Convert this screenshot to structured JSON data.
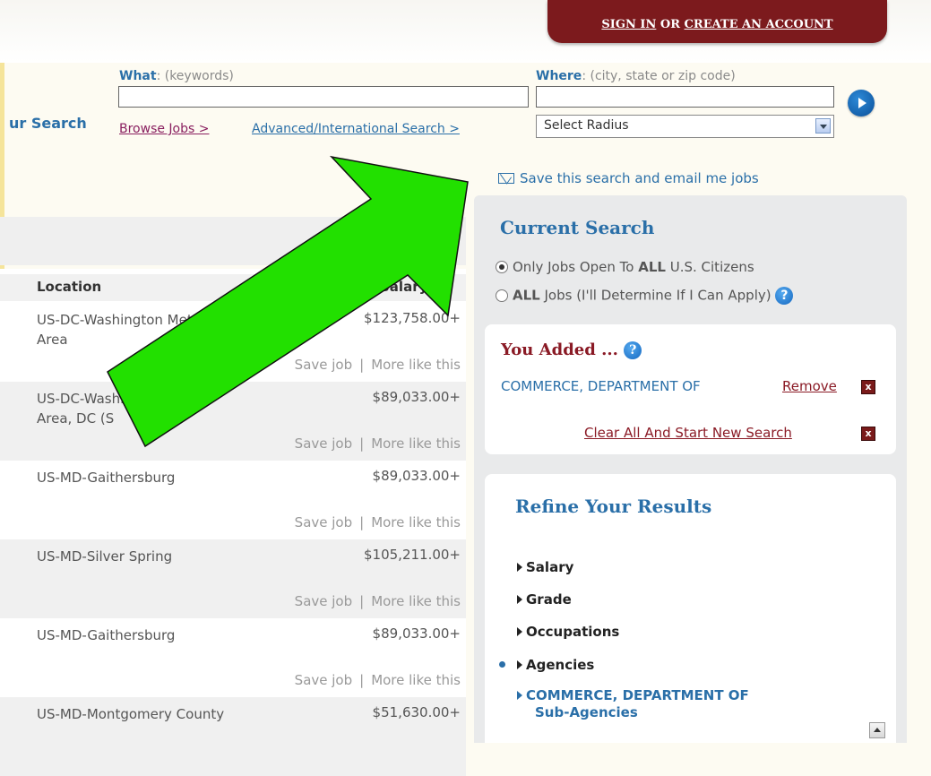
{
  "header": {
    "sign_in": "SIGN IN",
    "or": " OR ",
    "create_account": "CREATE AN ACCOUNT"
  },
  "search": {
    "label": "ur Search",
    "what_label": "What",
    "what_hint": ": (keywords)",
    "where_label": "Where",
    "where_hint": ": (city, state or zip code)",
    "what_value": "",
    "where_value": "",
    "browse_jobs": "Browse Jobs >",
    "advanced_search": "Advanced/International Search >",
    "radius": "Select Radius",
    "save_search": "Save this search and email me jobs"
  },
  "results": {
    "col_location": "Location",
    "col_salary": "Salary",
    "save_job": "Save job",
    "separator": "|",
    "more_like": "More like this",
    "rows": [
      {
        "location": "US-DC-Washington Metro Area",
        "salary": "$123,758.00+"
      },
      {
        "location": "US-DC-Washington Metro Area, DC (S",
        "salary": "$89,033.00+"
      },
      {
        "location": "US-MD-Gaithersburg",
        "salary": "$89,033.00+"
      },
      {
        "location": "US-MD-Silver Spring",
        "salary": "$105,211.00+"
      },
      {
        "location": "US-MD-Gaithersburg",
        "salary": "$89,033.00+"
      },
      {
        "location": "US-MD-Montgomery County",
        "salary": "$51,630.00+"
      }
    ]
  },
  "current_search": {
    "title": "Current Search",
    "opt1_pre": "Only Jobs Open To ",
    "opt1_bold": "ALL",
    "opt1_post": " U.S. Citizens",
    "opt2_bold": "ALL",
    "opt2_post": " Jobs (I'll Determine If I Can Apply)",
    "help": "?"
  },
  "you_added": {
    "title": "You Added ...",
    "item": "COMMERCE, DEPARTMENT OF",
    "remove": "Remove",
    "clear_all": "Clear All And Start New Search",
    "x": "x"
  },
  "refine": {
    "title": "Refine Your Results",
    "facets": [
      "Salary",
      "Grade",
      "Occupations",
      "Agencies"
    ],
    "agency_line1": "COMMERCE, DEPARTMENT OF",
    "agency_line2": "Sub-Agencies"
  },
  "colors": {
    "accent_blue": "#2a6fa8",
    "brand_maroon": "#7c1a1d",
    "arrow_green": "#22e000"
  },
  "overlay_icon": "green-arrow"
}
